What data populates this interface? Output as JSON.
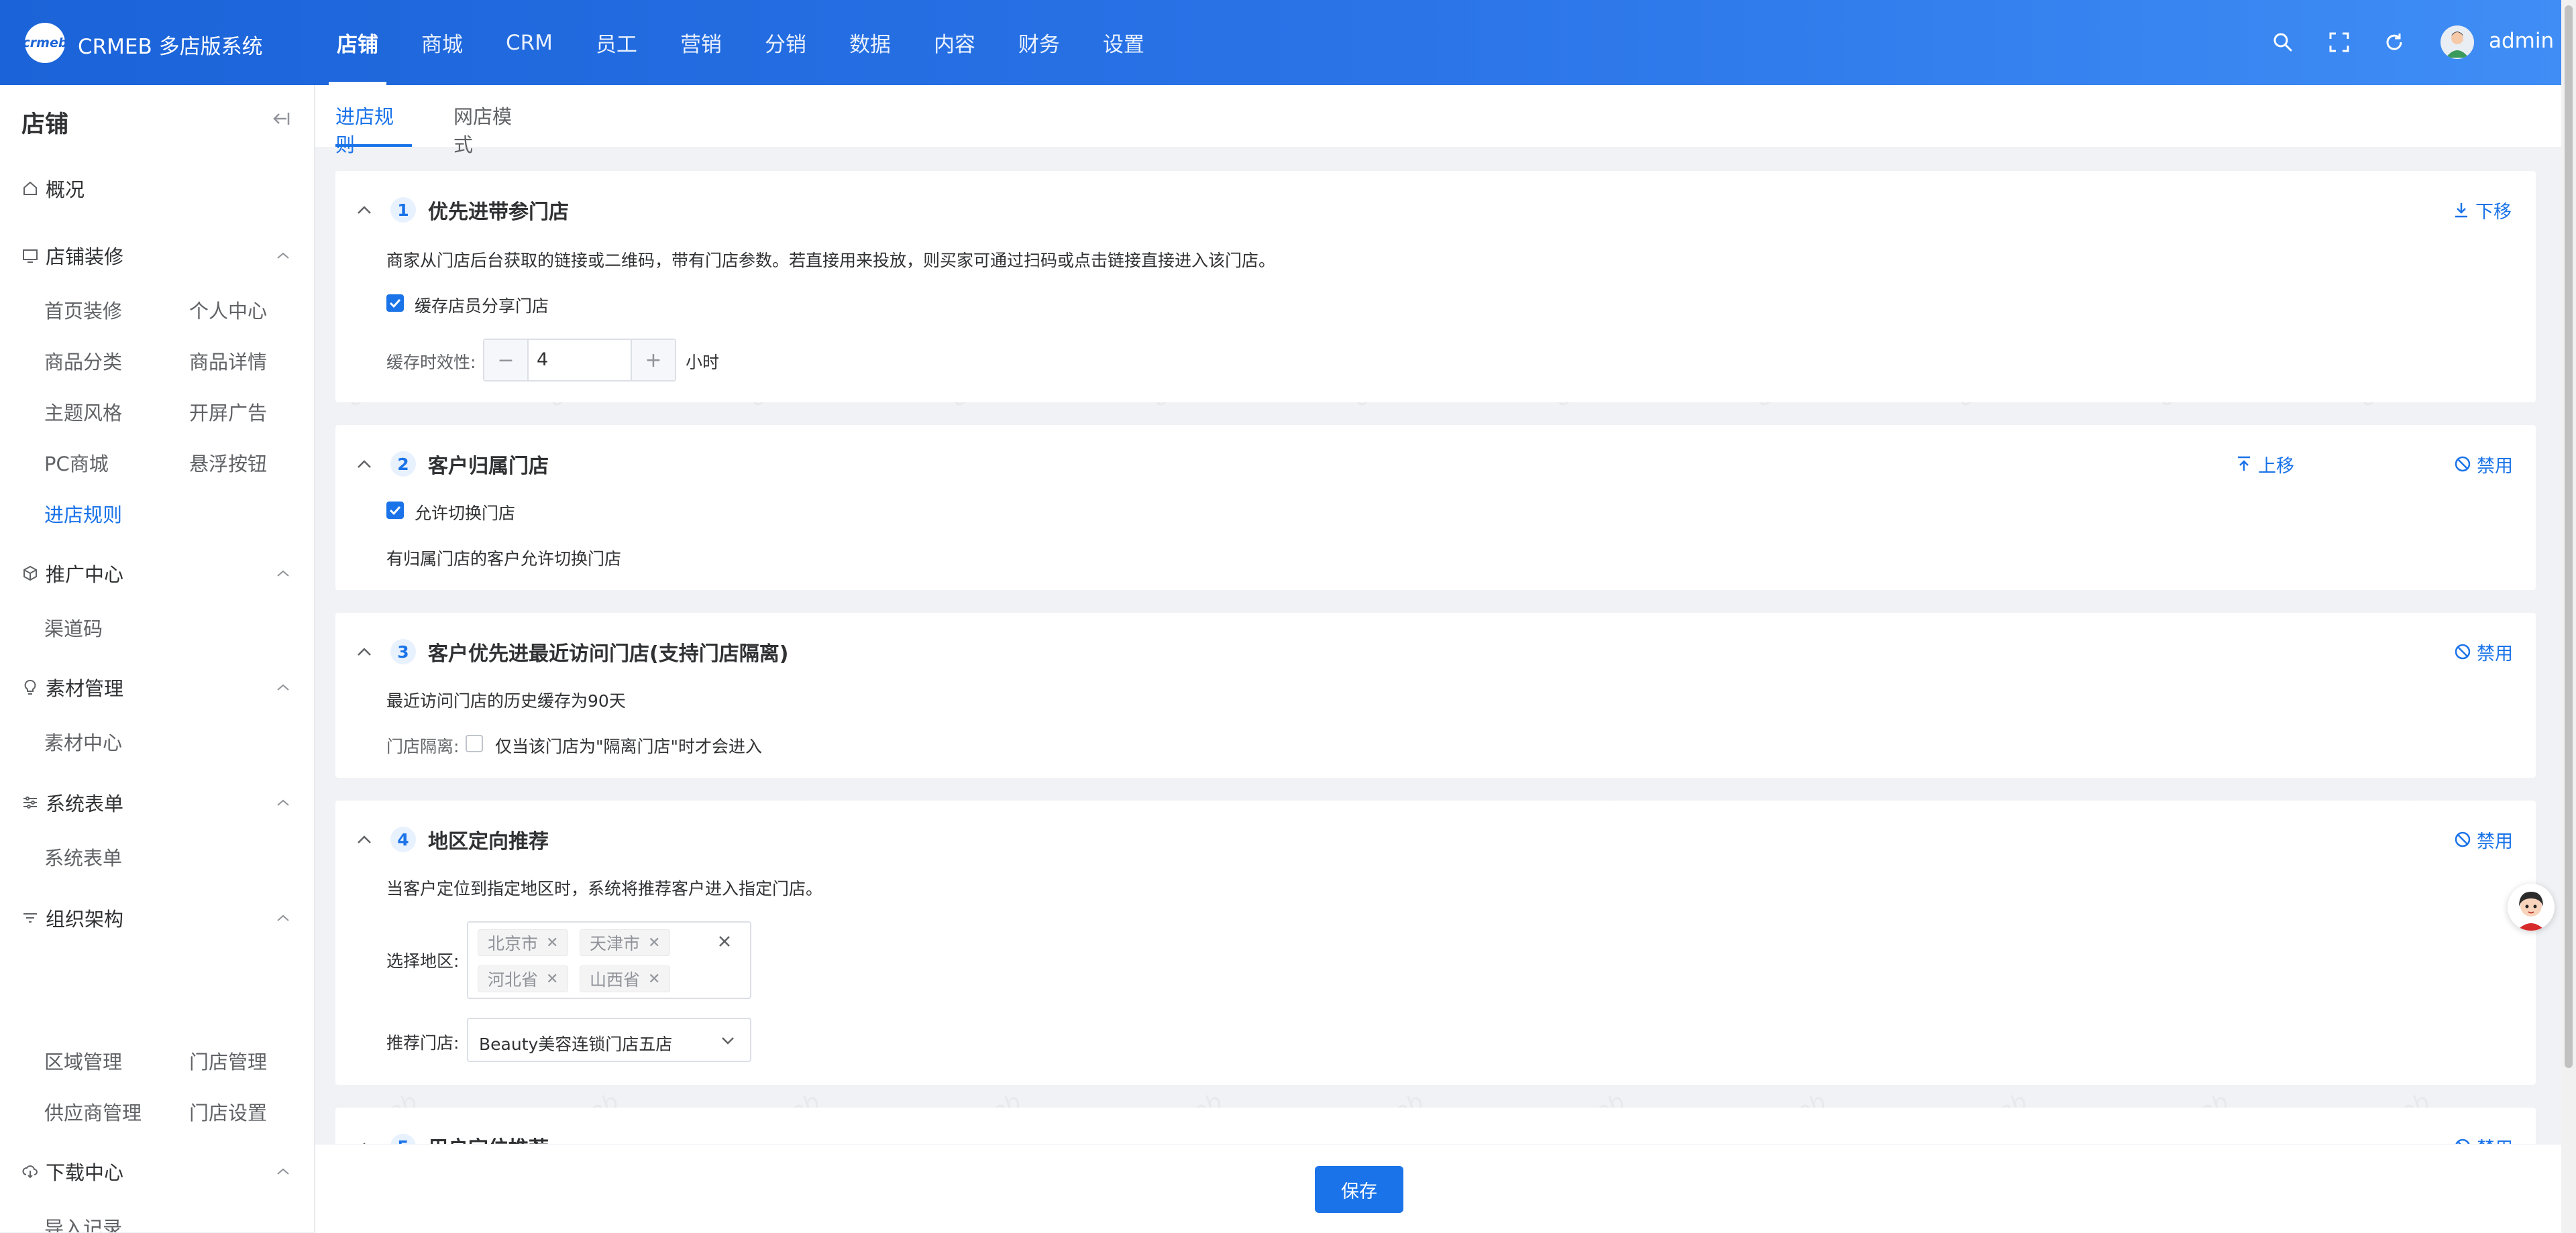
{
  "header": {
    "logo_text": "crmeb",
    "app_title": "CRMEB 多店版系统",
    "nav": [
      "店铺",
      "商城",
      "CRM",
      "员工",
      "营销",
      "分销",
      "数据",
      "内容",
      "财务",
      "设置"
    ],
    "active_nav": "店铺",
    "username": "admin",
    "icons": [
      "search-icon",
      "fullscreen-icon",
      "refresh-icon",
      "avatar"
    ]
  },
  "sidebar": {
    "title": "店铺",
    "overview": "概况",
    "groups": [
      {
        "label": "店铺装修",
        "icon": "monitor-icon",
        "items": [
          "首页装修",
          "个人中心",
          "商品分类",
          "商品详情",
          "主题风格",
          "开屏广告",
          "PC商城",
          "悬浮按钮",
          "进店规则"
        ]
      },
      {
        "label": "推广中心",
        "icon": "cube-icon",
        "items": [
          "渠道码"
        ]
      },
      {
        "label": "素材管理",
        "icon": "bulb-icon",
        "items": [
          "素材中心"
        ]
      },
      {
        "label": "系统表单",
        "icon": "form-icon",
        "items": [
          "系统表单"
        ]
      },
      {
        "label": "组织架构",
        "icon": "filter-icon",
        "items": [
          "区域管理",
          "门店管理",
          "供应商管理",
          "门店设置"
        ]
      },
      {
        "label": "下载中心",
        "icon": "cloud-download-icon",
        "items": [
          "导入记录"
        ]
      }
    ],
    "active_item": "进店规则"
  },
  "tabs": [
    "进店规则",
    "网店模式"
  ],
  "active_tab": "进店规则",
  "cards": [
    {
      "num": "1",
      "title": "优先进带参门店",
      "actions": [
        "下移"
      ],
      "description": "商家从门店后台获取的链接或二维码，带有门店参数。若直接用来投放，则买家可通过扫码或点击链接直接进入该门店。",
      "checkbox_label": "缓存店员分享门店",
      "checkbox_checked": true,
      "stepper_label": "缓存时效性:",
      "stepper_minus": "−",
      "stepper_plus": "+",
      "stepper_value": "4",
      "stepper_unit": "小时"
    },
    {
      "num": "2",
      "title": "客户归属门店",
      "actions": [
        "上移",
        "禁用"
      ],
      "checkbox_label": "允许切换门店",
      "checkbox_checked": true,
      "description": "有归属门店的客户允许切换门店"
    },
    {
      "num": "3",
      "title": "客户优先进最近访问门店(支持门店隔离)",
      "actions": [
        "禁用"
      ],
      "description": "最近访问门店的历史缓存为90天",
      "isolation_label": "门店隔离:",
      "checkbox_label": "仅当该门店为\"隔离门店\"时才会进入",
      "checkbox_checked": false
    },
    {
      "num": "4",
      "title": "地区定向推荐",
      "actions": [
        "禁用"
      ],
      "description": "当客户定位到指定地区时，系统将推荐客户进入指定门店。",
      "region_label": "选择地区:",
      "regions": [
        "北京市",
        "天津市",
        "河北省",
        "山西省"
      ],
      "store_label": "推荐门店:",
      "store_value": "Beauty美容连锁门店五店"
    },
    {
      "num": "5",
      "title": "用户定位推荐",
      "actions": [
        "禁用"
      ]
    }
  ],
  "footer": {
    "save_label": "保存"
  },
  "watermark_text": "crmeb",
  "colors": {
    "primary": "#1a73e8",
    "header_start": "#1b63d8",
    "header_end": "#3f8df5",
    "bg": "#f0f2f5"
  }
}
